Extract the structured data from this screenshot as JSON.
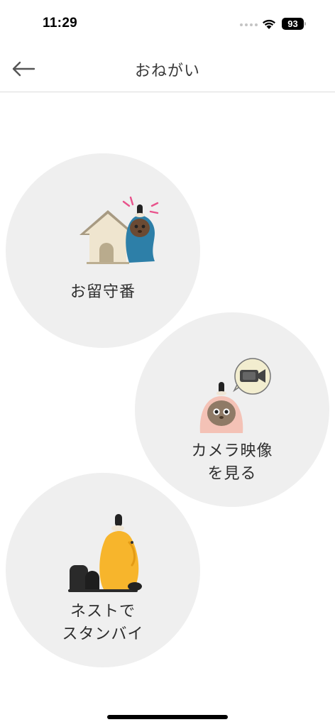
{
  "status_bar": {
    "time": "11:29",
    "battery": "93",
    "icons": [
      "signal-dots-icon",
      "wifi-icon",
      "battery-icon"
    ]
  },
  "nav": {
    "title": "おねがい",
    "back_icon": "arrow-left-icon"
  },
  "options": [
    {
      "label": "お留守番",
      "icon": "house-robot-icon"
    },
    {
      "label": "カメラ映像\nを見る",
      "icon": "robot-camera-icon"
    },
    {
      "label": "ネストで\nスタンバイ",
      "icon": "robot-nest-icon"
    }
  ],
  "colors": {
    "circle_bg": "#efefef",
    "text": "#2e2e2e",
    "robot_blue": "#2d7fa8",
    "robot_pink": "#f4c2b6",
    "robot_yellow": "#f7b52c"
  }
}
